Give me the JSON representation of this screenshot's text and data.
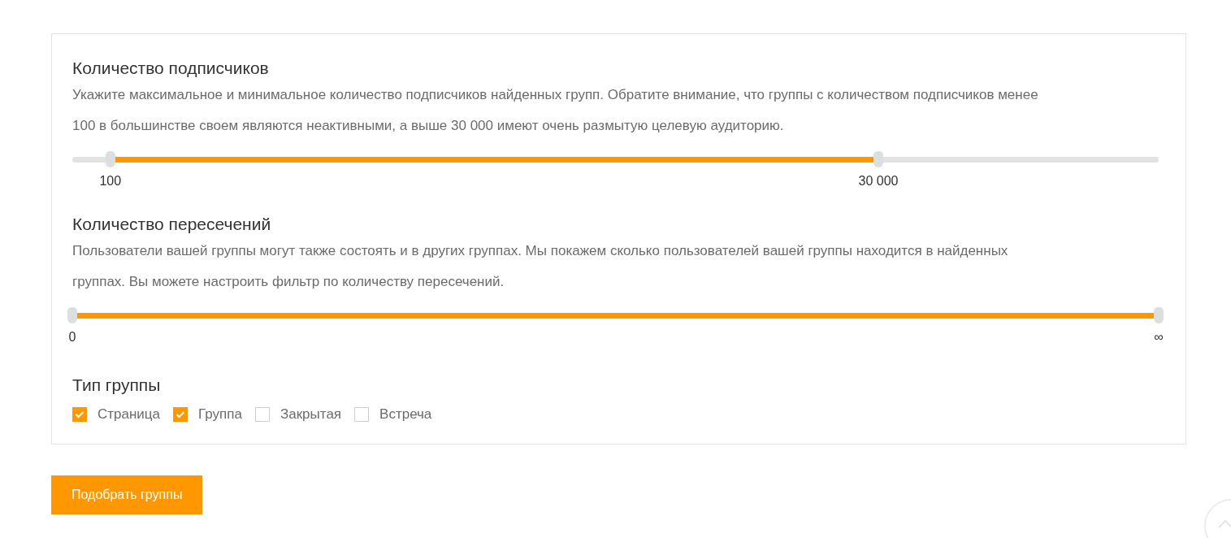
{
  "subscribers": {
    "title": "Количество подписчиков",
    "description": "Укажите максимальное и минимальное количество подписчиков найденных групп. Обратите внимание, что группы с количеством подписчиков менее 100 в большинстве своем являются неактивными, а выше 30 000 имеют очень размытую целевую аудиторию.",
    "low": {
      "level": 0.035,
      "label": "100"
    },
    "high": {
      "level": 0.742,
      "label": "30 000"
    }
  },
  "intersections": {
    "title": "Количество пересечений",
    "description": "Пользователи вашей группы могут также состоять и в других группах. Мы покажем сколько пользователей вашей группы находится в найденных группах. Вы можете настроить фильтр по количеству пересечений.",
    "low": {
      "level": 0,
      "label": "0"
    },
    "high": {
      "level": 1,
      "label": "∞"
    }
  },
  "group_type": {
    "title": "Тип группы",
    "options": [
      {
        "label": "Страница",
        "checked": true
      },
      {
        "label": "Группа",
        "checked": true
      },
      {
        "label": "Закрытая",
        "checked": false
      },
      {
        "label": "Встреча",
        "checked": false
      }
    ]
  },
  "submit": "Подобрать группы"
}
